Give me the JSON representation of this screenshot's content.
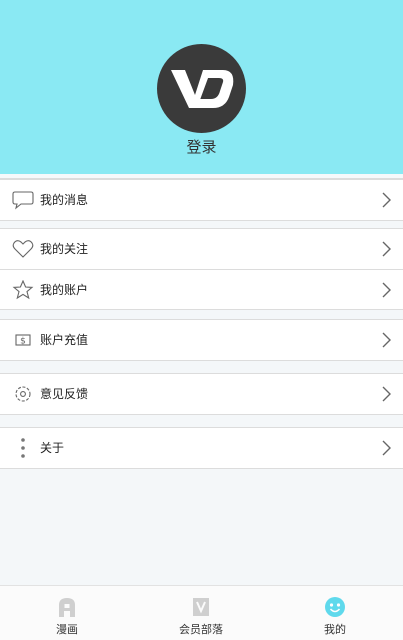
{
  "header": {
    "login_label": "登录",
    "background_color": "#8ae9f3",
    "avatar_icon": "vd-logo-icon"
  },
  "menu": {
    "groups": [
      {
        "items": [
          {
            "label": "我的消息",
            "icon": "message-bubble-icon"
          }
        ]
      },
      {
        "items": [
          {
            "label": "我的关注",
            "icon": "heart-icon"
          },
          {
            "label": "我的账户",
            "icon": "star-icon"
          }
        ]
      },
      {
        "items": [
          {
            "label": "账户充值",
            "icon": "dollar-bill-icon"
          }
        ]
      },
      {
        "items": [
          {
            "label": "意见反馈",
            "icon": "gear-icon"
          }
        ]
      },
      {
        "items": [
          {
            "label": "关于",
            "icon": "more-vertical-icon"
          }
        ]
      }
    ]
  },
  "tabbar": {
    "tabs": [
      {
        "label": "漫画",
        "icon": "comic-icon",
        "active": false
      },
      {
        "label": "会员部落",
        "icon": "vip-tribe-icon",
        "active": false
      },
      {
        "label": "我的",
        "icon": "smiley-face-icon",
        "active": true
      }
    ],
    "active_color": "#5fd9ec",
    "inactive_color": "#cfcfcf"
  }
}
